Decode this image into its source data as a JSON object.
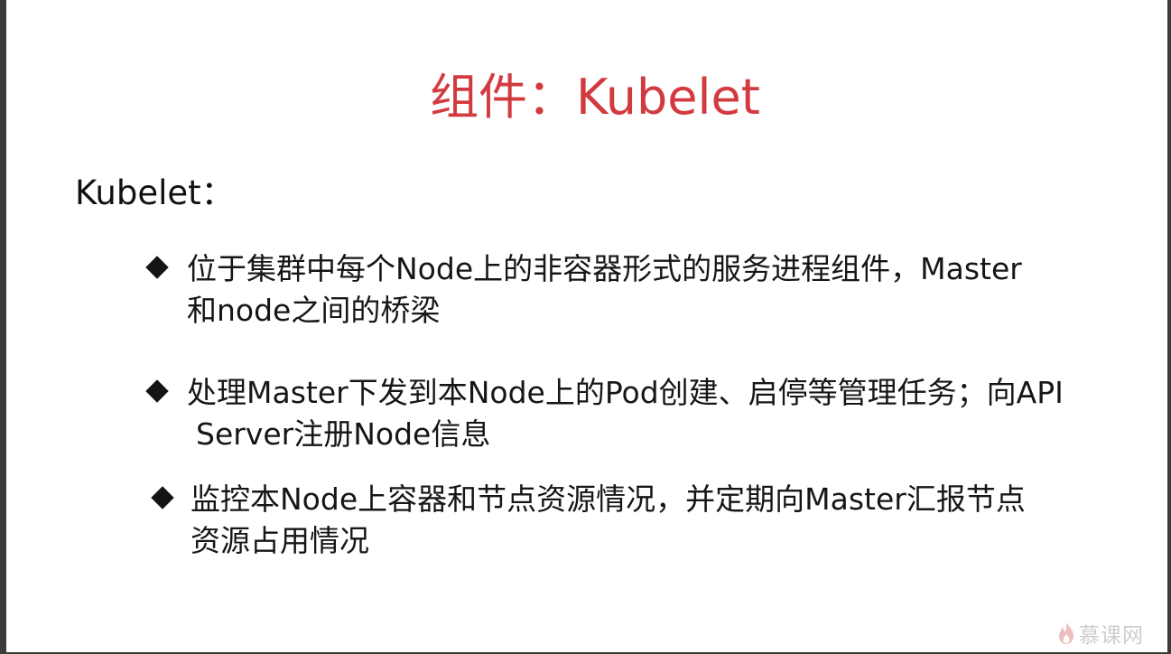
{
  "slide": {
    "title": "组件：Kubelet",
    "subheading": "Kubelet：",
    "bullets": [
      {
        "line1": "位于集群中每个Node上的非容器形式的服务进程组件，Master",
        "line2": "和node之间的桥梁"
      },
      {
        "line1": "处理Master下发到本Node上的Pod创建、启停等管理任务；向API",
        "line2": "Server注册Node信息"
      },
      {
        "line1": "监控本Node上容器和节点资源情况，并定期向Master汇报节点",
        "line2": "资源占用情况"
      }
    ]
  },
  "watermark": {
    "brand": "慕课网",
    "icon": "flame-logo-icon"
  },
  "colors": {
    "title": "#d23a3f",
    "text": "#161616",
    "background": "#ffffff",
    "frame": "#3b3b3b"
  }
}
